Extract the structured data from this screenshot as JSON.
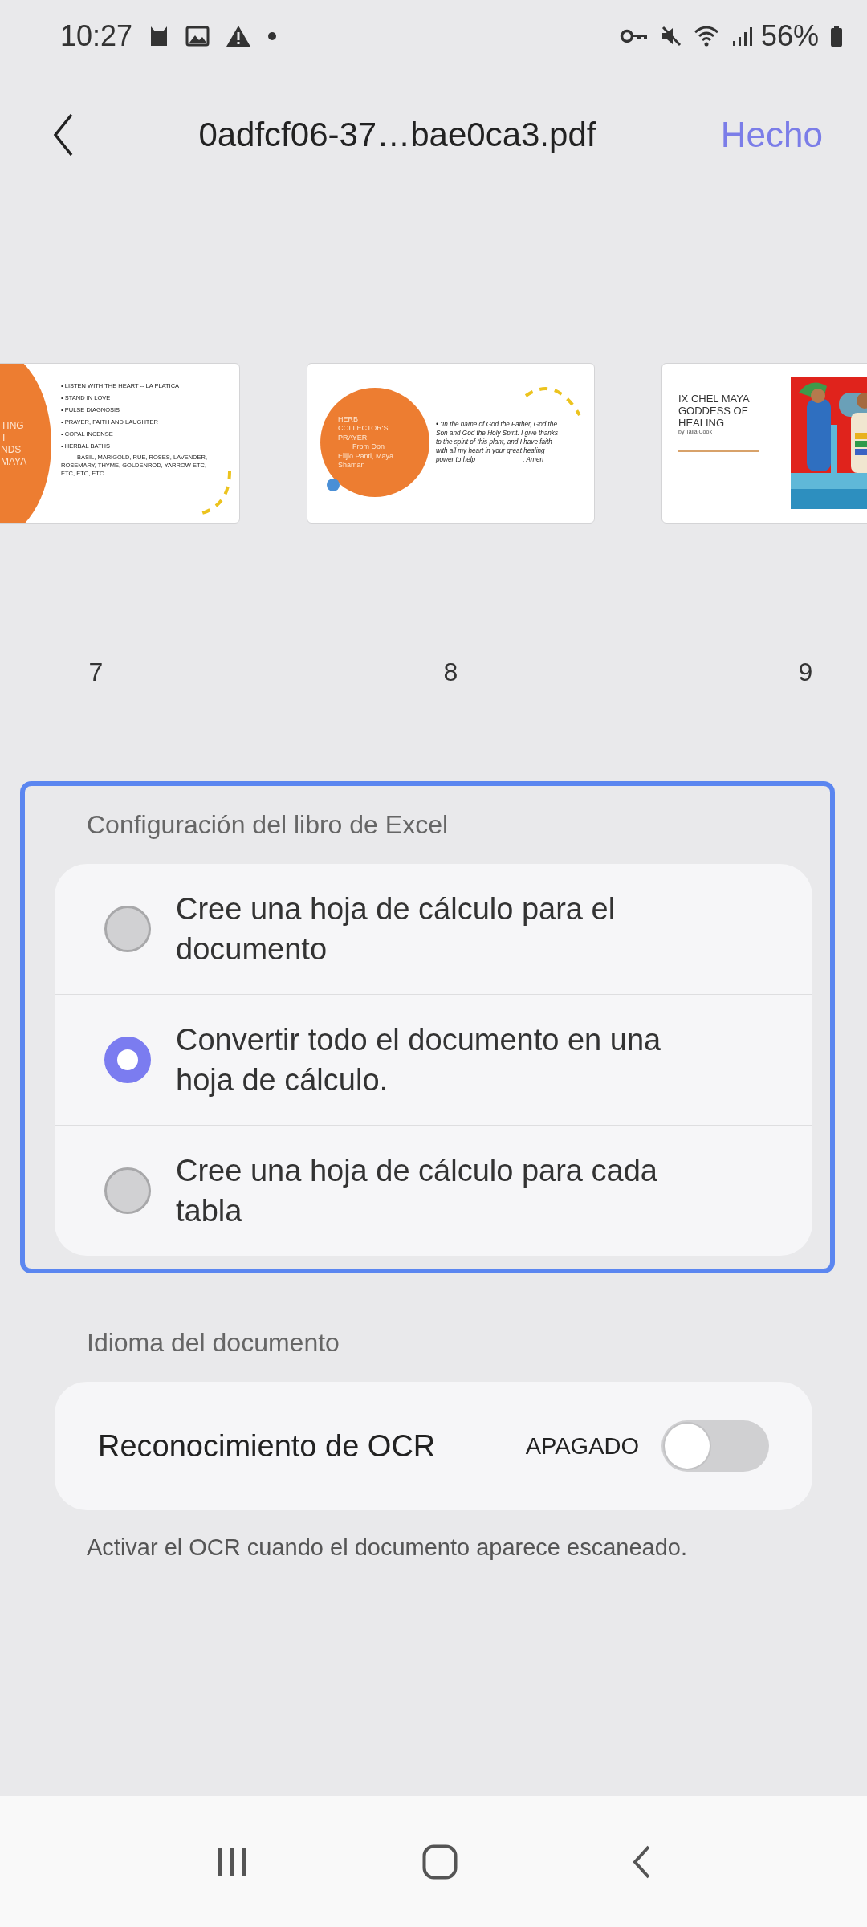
{
  "status_bar": {
    "time": "10:27",
    "battery": "56%"
  },
  "header": {
    "title": "0adfcf06-37…bae0ca3.pdf",
    "done": "Hecho"
  },
  "pages": [
    {
      "number": "7",
      "kind": "bullets",
      "circle_lines": [
        "TING",
        "T",
        "NDS",
        "MAYA"
      ],
      "bullets": [
        "• LISTEN WITH THE HEART  -- LA PLATICA",
        "• STAND IN LOVE",
        "• PULSE DIAGNOSIS",
        "• PRAYER, FAITH AND LAUGHTER",
        "• COPAL INCENSE",
        "• HERBAL BATHS"
      ],
      "note": "BASIL, MARIGOLD, RUE, ROSES, LAVENDER, ROSEMARY, THYME, GOLDENROD, YARROW ETC, ETC, ETC, ETC"
    },
    {
      "number": "8",
      "kind": "quote",
      "circle_lines": [
        "HERB",
        "COLLECTOR'S",
        "PRAYER",
        "From Don",
        "Elijio Panti, Maya",
        "Shaman"
      ],
      "quote": "• \"In the name of God the Father, God the Son and God the Holy Spirit. I give thanks to the spirit of this plant, and I have faith with all my heart in your great healing power to help_____________. Amen"
    },
    {
      "number": "9",
      "kind": "picture",
      "title": "IX CHEL MAYA GODDESS OF HEALING",
      "byline": "by Talia Cook"
    }
  ],
  "excel": {
    "label": "Configuración del libro de Excel",
    "options": [
      {
        "text": "Cree una hoja de cálculo para el documento",
        "selected": false
      },
      {
        "text": "Convertir todo el documento en una hoja de cálculo.",
        "selected": true
      },
      {
        "text": "Cree una hoja de cálculo para cada tabla",
        "selected": false
      }
    ]
  },
  "language": {
    "label": "Idioma del documento",
    "ocr": {
      "label": "Reconocimiento de OCR",
      "state": "APAGADO",
      "on": false
    },
    "hint": "Activar el OCR cuando el documento aparece escaneado."
  }
}
